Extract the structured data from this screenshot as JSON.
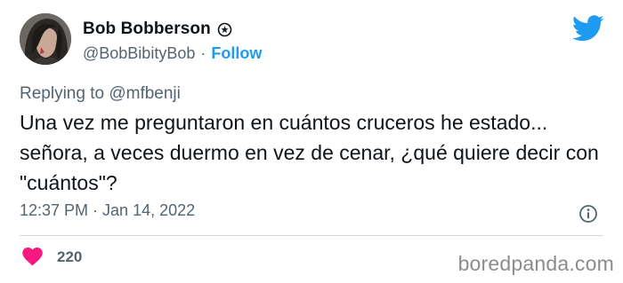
{
  "author": {
    "display_name": "Bob Bobberson",
    "handle": "@BobBibityBob",
    "separator": "·",
    "follow_label": "Follow"
  },
  "reply": {
    "text": "Replying to @mfbenji"
  },
  "tweet": {
    "text": "Una vez me preguntaron en cuántos cruceros he estado... señora, a veces duermo en vez de cenar, ¿qué quiere decir con \"cuántos\"?",
    "timestamp": "12:37 PM · Jan 14, 2022"
  },
  "engagement": {
    "likes": "220"
  },
  "watermark": {
    "text": "boredpanda.com"
  },
  "icons": {
    "verified_badge": "badge-icon",
    "brand": "twitter-bird-icon",
    "info": "info-icon",
    "like": "heart-icon"
  },
  "colors": {
    "accent": "#1d9bf0",
    "text_primary": "#0f1419",
    "text_secondary": "#536471",
    "like": "#f91880",
    "divider": "#cfd9de"
  }
}
